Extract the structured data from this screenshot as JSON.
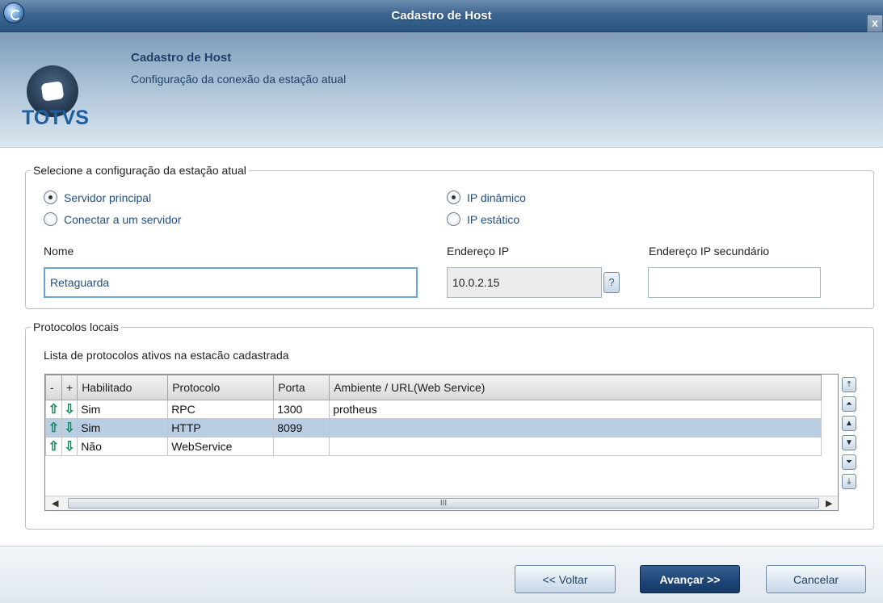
{
  "window": {
    "title": "Cadastro de Host",
    "close_label": "x"
  },
  "header": {
    "logo_text": "TOTVS",
    "title": "Cadastro de Host",
    "subtitle": "Configuração da conexão da estação atual"
  },
  "config_group": {
    "legend": "Selecione a configuração da estação atual",
    "server_options": [
      {
        "label": "Servidor principal",
        "checked": true
      },
      {
        "label": "Conectar a um servidor",
        "checked": false
      }
    ],
    "ip_options": [
      {
        "label": "IP dinâmico",
        "checked": true
      },
      {
        "label": "IP estático",
        "checked": false
      }
    ],
    "name_label": "Nome",
    "name_value": "Retaguarda",
    "ip_label": "Endereço IP",
    "ip_value": "10.0.2.15",
    "help_label": "?",
    "ip_secondary_label": "Endereço IP secundário",
    "ip_secondary_value": ""
  },
  "protocols_group": {
    "legend": "Protocolos locais",
    "caption": "Lista de protocolos ativos na estacão cadastrada",
    "columns": [
      "-",
      "+",
      "Habilitado",
      "Protocolo",
      "Porta",
      "Ambiente / URL(Web Service)"
    ],
    "rows": [
      {
        "habilitado": "Sim",
        "protocolo": "RPC",
        "porta": "1300",
        "ambiente": "protheus",
        "selected": false
      },
      {
        "habilitado": "Sim",
        "protocolo": "HTTP",
        "porta": "8099",
        "ambiente": "",
        "selected": true
      },
      {
        "habilitado": "Não",
        "protocolo": "WebService",
        "porta": "",
        "ambiente": "",
        "selected": false
      }
    ],
    "scroll_thumb_label": "III"
  },
  "footer": {
    "back_label": "<< Voltar",
    "next_label": "Avançar >>",
    "cancel_label": "Cancelar"
  },
  "colors": {
    "titlebar": "#2a557f",
    "primary_button": "#1f4678",
    "selected_row": "#b9cde3",
    "label_blue": "#1f4f7e"
  }
}
